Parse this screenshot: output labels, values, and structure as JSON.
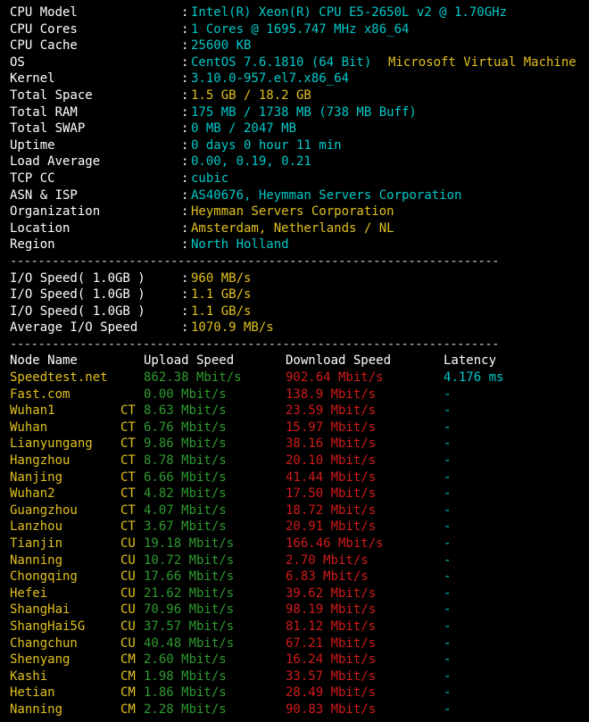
{
  "sysinfo": [
    {
      "key": "CPU Model",
      "value": "Intel(R) Xeon(R) CPU E5-2650L v2 @ 1.70GHz",
      "value2": ""
    },
    {
      "key": "CPU Cores",
      "value": "1 Cores @ 1695.747 MHz x86_64",
      "value2": ""
    },
    {
      "key": "CPU Cache",
      "value": "25600 KB",
      "value2": ""
    },
    {
      "key": "OS",
      "value": "CentOS 7.6.1810 (64 Bit)",
      "value2": "Microsoft Virtual Machine"
    },
    {
      "key": "Kernel",
      "value": "3.10.0-957.el7.x86_64",
      "value2": ""
    },
    {
      "key": "Total Space",
      "value": "1.5 GB / 18.2 GB",
      "value2": ""
    },
    {
      "key": "Total RAM",
      "value": "175 MB / 1738 MB (738 MB Buff)",
      "value2": ""
    },
    {
      "key": "Total SWAP",
      "value": "0 MB / 2047 MB",
      "value2": ""
    },
    {
      "key": "Uptime",
      "value": "0 days 0 hour 11 min",
      "value2": ""
    },
    {
      "key": "Load Average",
      "value": "0.00, 0.19, 0.21",
      "value2": ""
    },
    {
      "key": "TCP CC",
      "value": "cubic",
      "value2": ""
    },
    {
      "key": "ASN & ISP",
      "value": "AS40676, Heymman Servers Corporation",
      "value2": ""
    },
    {
      "key": "Organization",
      "value": "Heymman Servers Corporation",
      "value2": ""
    },
    {
      "key": "Location",
      "value": "Amsterdam, Netherlands / NL",
      "value2": ""
    },
    {
      "key": "Region",
      "value": "North Holland",
      "value2": ""
    }
  ],
  "separator": "----------------------------------------------------------------------",
  "io": [
    {
      "key": "I/O Speed( 1.0GB )",
      "value": "960 MB/s"
    },
    {
      "key": "I/O Speed( 1.0GB )",
      "value": "1.1 GB/s"
    },
    {
      "key": "I/O Speed( 1.0GB )",
      "value": "1.1 GB/s"
    },
    {
      "key": "Average I/O Speed",
      "value": "1070.9 MB/s"
    }
  ],
  "colon": ":",
  "speed_headers": {
    "node": "Node Name",
    "upload": "Upload Speed",
    "download": "Download Speed",
    "latency": "Latency"
  },
  "speed_rows": [
    {
      "node": "Speedtest.net",
      "isp": "",
      "upload": "862.38 Mbit/s",
      "download": "902.64 Mbit/s",
      "latency": "4.176 ms"
    },
    {
      "node": "Fast.com",
      "isp": "",
      "upload": "0.00 Mbit/s",
      "download": "138.9 Mbit/s",
      "latency": "-"
    },
    {
      "node": "Wuhan1",
      "isp": "CT",
      "upload": "8.63 Mbit/s",
      "download": "23.59 Mbit/s",
      "latency": "-"
    },
    {
      "node": "Wuhan",
      "isp": "CT",
      "upload": "6.76 Mbit/s",
      "download": "15.97 Mbit/s",
      "latency": "-"
    },
    {
      "node": "Lianyungang",
      "isp": "CT",
      "upload": "9.86 Mbit/s",
      "download": "38.16 Mbit/s",
      "latency": "-"
    },
    {
      "node": "Hangzhou",
      "isp": "CT",
      "upload": "8.78 Mbit/s",
      "download": "20.10 Mbit/s",
      "latency": "-"
    },
    {
      "node": "Nanjing",
      "isp": "CT",
      "upload": "6.66 Mbit/s",
      "download": "41.44 Mbit/s",
      "latency": "-"
    },
    {
      "node": "Wuhan2",
      "isp": "CT",
      "upload": "4.82 Mbit/s",
      "download": "17.50 Mbit/s",
      "latency": "-"
    },
    {
      "node": "Guangzhou",
      "isp": "CT",
      "upload": "4.07 Mbit/s",
      "download": "18.72 Mbit/s",
      "latency": "-"
    },
    {
      "node": "Lanzhou",
      "isp": "CT",
      "upload": "3.67 Mbit/s",
      "download": "20.91 Mbit/s",
      "latency": "-"
    },
    {
      "node": "Tianjin",
      "isp": "CU",
      "upload": "19.18 Mbit/s",
      "download": "166.46 Mbit/s",
      "latency": "-"
    },
    {
      "node": "Nanning",
      "isp": "CU",
      "upload": "10.72 Mbit/s",
      "download": "2.70 Mbit/s",
      "latency": "-"
    },
    {
      "node": "Chongqing",
      "isp": "CU",
      "upload": "17.66 Mbit/s",
      "download": "6.83 Mbit/s",
      "latency": "-"
    },
    {
      "node": "Hefei",
      "isp": "CU",
      "upload": "21.62 Mbit/s",
      "download": "39.62 Mbit/s",
      "latency": "-"
    },
    {
      "node": "ShangHai",
      "isp": "CU",
      "upload": "70.96 Mbit/s",
      "download": "98.19 Mbit/s",
      "latency": "-"
    },
    {
      "node": "ShangHai5G",
      "isp": "CU",
      "upload": "37.57 Mbit/s",
      "download": "81.12 Mbit/s",
      "latency": "-"
    },
    {
      "node": "Changchun",
      "isp": "CU",
      "upload": "40.48 Mbit/s",
      "download": "67.21 Mbit/s",
      "latency": "-"
    },
    {
      "node": "Shenyang",
      "isp": "CM",
      "upload": "2.60 Mbit/s",
      "download": "16.24 Mbit/s",
      "latency": "-"
    },
    {
      "node": "Kashi",
      "isp": "CM",
      "upload": "1.98 Mbit/s",
      "download": "33.57 Mbit/s",
      "latency": "-"
    },
    {
      "node": "Hetian",
      "isp": "CM",
      "upload": "1.86 Mbit/s",
      "download": "28.49 Mbit/s",
      "latency": "-"
    },
    {
      "node": "Nanning",
      "isp": "CM",
      "upload": "2.28 Mbit/s",
      "download": "90.83 Mbit/s",
      "latency": "-"
    }
  ],
  "colors": {
    "background": "#000000",
    "label": "#ffffff",
    "teal": "#00c8c8",
    "yellow": "#e0c020",
    "green": "#2e9a2e",
    "red": "#d21a1a"
  }
}
